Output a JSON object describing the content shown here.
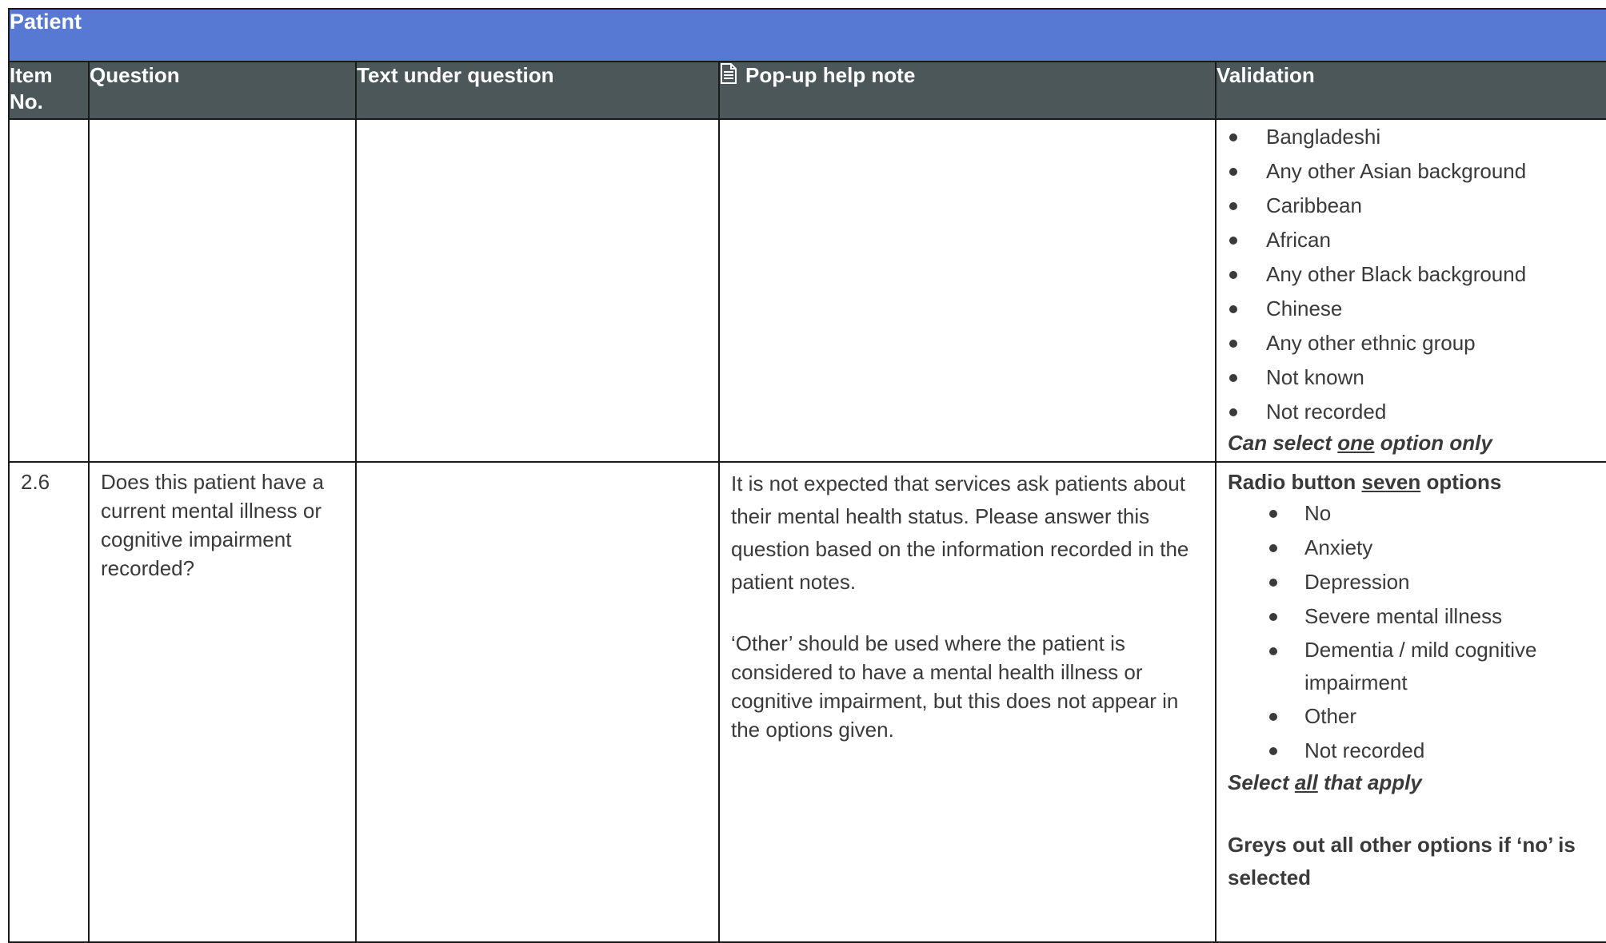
{
  "section_title": "Patient",
  "headers": {
    "item_no_line1": "Item",
    "item_no_line2": "No.",
    "question": "Question",
    "text_under": "Text under question",
    "popup": "Pop-up help note",
    "validation": "Validation"
  },
  "row1": {
    "validation_options": [
      "Bangladeshi",
      "Any other Asian background",
      "Caribbean",
      "African",
      "Any other Black background",
      "Chinese",
      "Any other ethnic group",
      "Not known",
      "Not recorded"
    ],
    "note_prefix": "Can select ",
    "note_emph": "one",
    "note_suffix": " option only"
  },
  "row2": {
    "item_no": "2.6",
    "question": "Does this patient have a current mental illness or cognitive impairment recorded?",
    "text_under": "",
    "help_para1": "It is not expected that services ask patients about their mental health status. Please answer this question based on the information recorded in the patient notes.",
    "help_para2": "‘Other’ should be used where the patient is considered to have a mental health illness or cognitive impairment, but this does not appear in the options given.",
    "radio_prefix": "Radio button ",
    "radio_emph": "seven",
    "radio_suffix": " options",
    "validation_options": [
      "No",
      "Anxiety",
      "Depression",
      "Severe mental illness",
      "Dementia / mild cognitive impairment",
      "Other",
      "Not recorded"
    ],
    "select_prefix": "Select ",
    "select_emph": "all",
    "select_suffix": " that apply",
    "greys_note": "Greys out all other options if ‘no’ is selected"
  }
}
